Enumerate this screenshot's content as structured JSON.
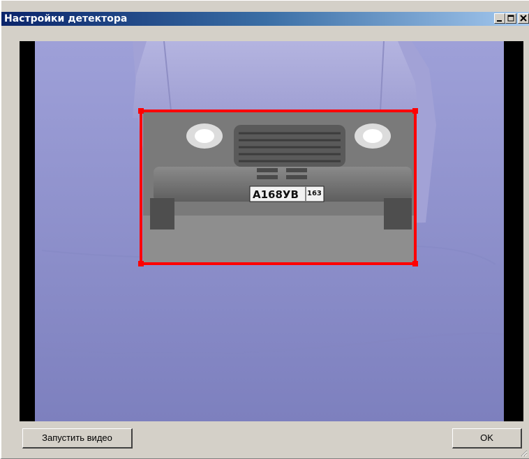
{
  "window": {
    "title": "Настройки детектора",
    "controls": [
      "minimize",
      "maximize",
      "close"
    ]
  },
  "video": {
    "plate_text": "А168УВ",
    "region_code": "163",
    "roi_color": "#ff0000"
  },
  "buttons": {
    "start_video": "Запустить видео",
    "ok": "OK"
  }
}
